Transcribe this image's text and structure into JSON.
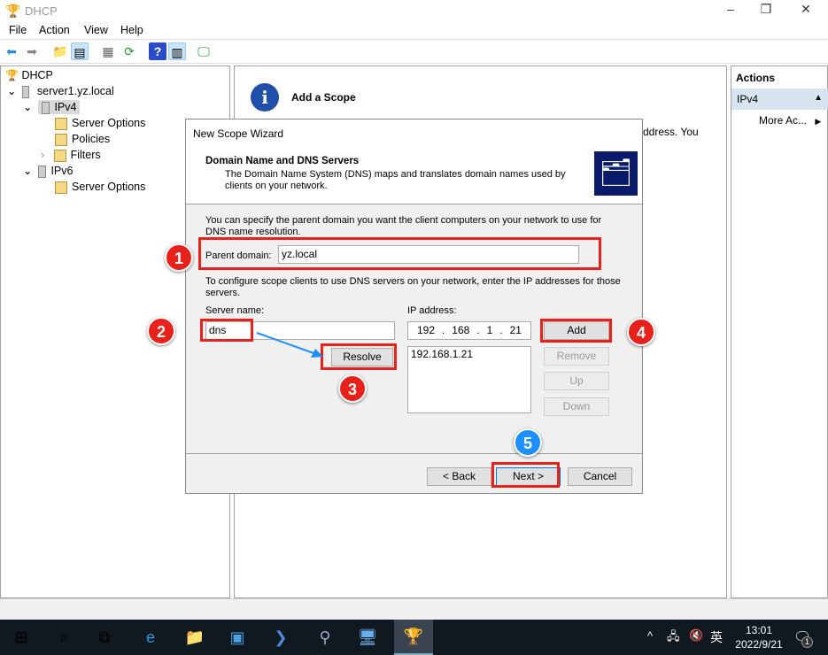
{
  "window": {
    "title": "DHCP",
    "minimize": "–",
    "restore": "❐",
    "close": "✕"
  },
  "menu": [
    "File",
    "Action",
    "View",
    "Help"
  ],
  "tree": {
    "root": "DHCP",
    "server": "server1.yz.local",
    "ipv4": "IPv4",
    "ipv4_children": [
      "Server Options",
      "Policies",
      "Filters"
    ],
    "ipv6": "IPv6",
    "ipv6_children": [
      "Server Options"
    ]
  },
  "middle": {
    "title": "Add a Scope",
    "partial_text": "ddress. You"
  },
  "actions": {
    "header": "Actions",
    "section": "IPv4",
    "more": "More Ac..."
  },
  "dialog": {
    "title": "New Scope Wizard",
    "heading": "Domain Name and DNS Servers",
    "subheading": "The Domain Name System (DNS) maps and translates domain names used by clients on your network.",
    "intro": "You can specify the parent domain you want the client computers on your network to use for DNS name resolution.",
    "parent_domain_label": "Parent domain:",
    "parent_domain_value": "yz.local",
    "config_text": "To configure scope clients to use DNS servers on your network, enter the IP addresses for those servers.",
    "server_name_label": "Server name:",
    "server_name_value": "dns",
    "ip_label": "IP address:",
    "ip_octets": [
      "192",
      "168",
      "1",
      "21"
    ],
    "ip_list": [
      "192.168.1.21"
    ],
    "buttons": {
      "resolve": "Resolve",
      "add": "Add",
      "remove": "Remove",
      "up": "Up",
      "down": "Down",
      "back": "< Back",
      "next": "Next >",
      "cancel": "Cancel"
    }
  },
  "annotations": [
    "1",
    "2",
    "3",
    "4",
    "5"
  ],
  "taskbar": {
    "time": "13:01",
    "date": "2022/9/21",
    "ime": "英",
    "notifications": "1"
  },
  "colors": {
    "annotation_red": "#e8221a",
    "annotation_blue": "#1e90ff"
  }
}
